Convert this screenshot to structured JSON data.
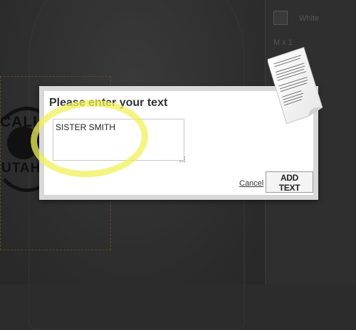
{
  "background": {
    "graphic": {
      "top_text": "CALLED",
      "bottom_text": "UTAH PR"
    }
  },
  "sidebar": {
    "color_option": "White",
    "quantity": "M x 1"
  },
  "dialog": {
    "title": "Please enter your text",
    "input_value": "SISTER SMITH",
    "cancel_label": "Cancel",
    "add_label": "ADD TEXT"
  },
  "colors": {
    "overlay_bg": "#2c2c2c",
    "dialog_border": "#d8d8d8",
    "highlight": "#f0f05a",
    "print_area_border": "#5a4a2a"
  },
  "icons": {
    "document": "document-page-icon"
  }
}
